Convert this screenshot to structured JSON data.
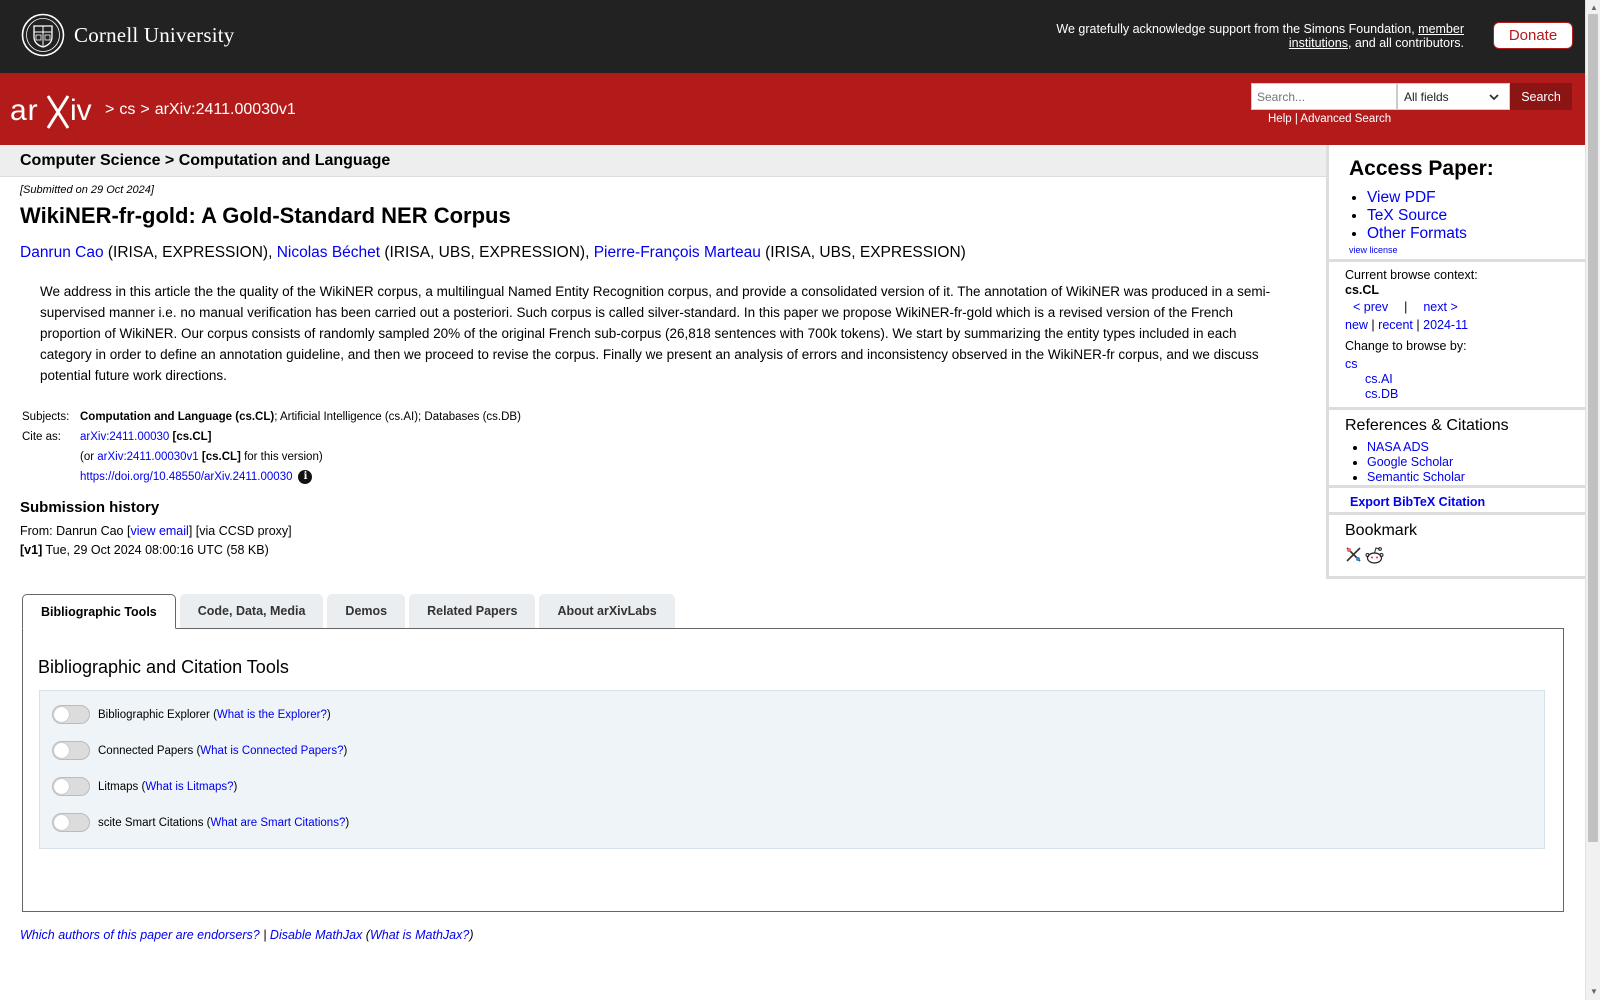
{
  "top_bar": {
    "brand": "Cornell University",
    "support_prefix": "We gratefully acknowledge support from the Simons Foundation, ",
    "support_link": "member institutions",
    "support_suffix": ", and all contributors.",
    "donate_label": "Donate"
  },
  "header": {
    "breadcrumb": [
      ">",
      "cs",
      ">",
      "arXiv:2411.00030v1"
    ],
    "search_placeholder": "Search...",
    "field_select": "All fields",
    "search_button": "Search",
    "help": "Help",
    "sep": "|",
    "advanced_search": "Advanced Search"
  },
  "subheader": {
    "title": "Computer Science > Computation and Language"
  },
  "paper": {
    "submitted": "[Submitted on 29 Oct 2024]",
    "title": "WikiNER-fr-gold: A Gold-Standard NER Corpus",
    "authors": [
      {
        "name": "Danrun Cao",
        "affil": " (IRISA, EXPRESSION), "
      },
      {
        "name": "Nicolas Béchet",
        "affil": " (IRISA, UBS, EXPRESSION), "
      },
      {
        "name": "Pierre-François Marteau",
        "affil": " (IRISA, UBS, EXPRESSION)"
      }
    ],
    "abstract": "We address in this article the the quality of the WikiNER corpus, a multilingual Named Entity Recognition corpus, and provide a consolidated version of it. The annotation of WikiNER was produced in a semi-supervised manner i.e. no manual verification has been carried out a posteriori. Such corpus is called silver-standard. In this paper we propose WikiNER-fr-gold which is a revised version of the French proportion of WikiNER. Our corpus consists of randomly sampled 20% of the original French sub-corpus (26,818 sentences with 700k tokens). We start by summarizing the entity types included in each category in order to define an annotation guideline, and then we proceed to revise the corpus. Finally we present an analysis of errors and inconsistency observed in the WikiNER-fr corpus, and we discuss potential future work directions."
  },
  "meta": {
    "subjects_label": "Subjects:",
    "subjects_primary": "Computation and Language (cs.CL)",
    "subjects_rest": "; Artificial Intelligence (cs.AI); Databases (cs.DB)",
    "cite_label": "Cite as:",
    "cite_id": "arXiv:2411.00030",
    "cite_cat": " [cs.CL]",
    "or_prefix": "(or ",
    "cite_version": "arXiv:2411.00030v1",
    "cite_version_cat": " [cs.CL]",
    "or_suffix": " for this version)",
    "doi": "https://doi.org/10.48550/arXiv.2411.00030",
    "info_glyph": "i"
  },
  "history": {
    "title": "Submission history",
    "from_prefix": "From: Danrun Cao [",
    "view_email": "view email",
    "from_suffix": "] [via CCSD proxy]",
    "v1_label": "[v1]",
    "v1_text": " Tue, 29 Oct 2024 08:00:16 UTC (58 KB)"
  },
  "sidebar": {
    "access_title": "Access Paper:",
    "access_links": [
      "View PDF",
      "TeX Source",
      "Other Formats"
    ],
    "view_license": "view license",
    "ctx_label": "Current browse context:",
    "ctx_value": "cs.CL",
    "prev": "< prev",
    "nav_sep": "|",
    "next": "next >",
    "ctx_new": "new",
    "ctx_recent": "recent",
    "ctx_month": "2024-11",
    "browse_label": "Change to browse by:",
    "browse_cs": "cs",
    "browse_ai": "cs.AI",
    "browse_db": "cs.DB",
    "refs_title": "References & Citations",
    "refs_links": [
      "NASA ADS",
      "Google Scholar",
      "Semantic Scholar"
    ],
    "bibtex": "Export BibTeX Citation",
    "bookmark_title": "Bookmark"
  },
  "tabs": [
    "Bibliographic Tools",
    "Code, Data, Media",
    "Demos",
    "Related Papers",
    "About arXivLabs"
  ],
  "panel": {
    "title": "Bibliographic and Citation Tools",
    "toggles": [
      {
        "label": "Bibliographic Explorer",
        "link": "What is the Explorer?"
      },
      {
        "label": "Connected Papers",
        "link": "What is Connected Papers?"
      },
      {
        "label": "Litmaps",
        "link": "What is Litmaps?"
      },
      {
        "label": "scite Smart Citations",
        "link": "What are Smart Citations?"
      }
    ]
  },
  "footer": {
    "endorsers": "Which authors of this paper are endorsers?",
    "sep": " | ",
    "disable_mathjax": "Disable MathJax",
    "mathjax_open": " (",
    "what_mathjax": "What is MathJax?",
    "mathjax_close": ")"
  },
  "colors": {
    "arxiv_red": "#b31b1b",
    "link_blue": "#0000ee",
    "top_bar": "#222222"
  }
}
